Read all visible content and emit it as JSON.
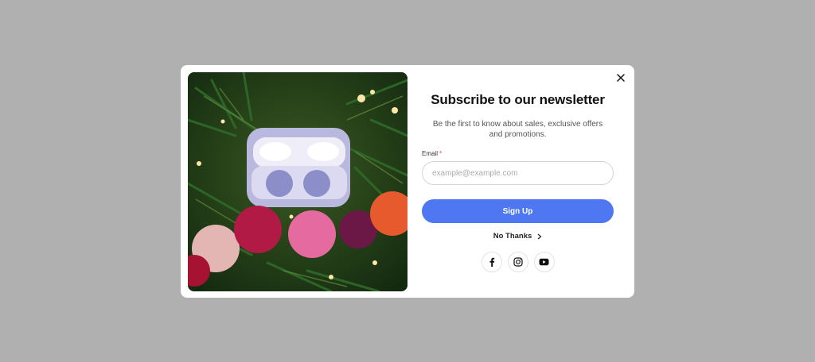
{
  "popup": {
    "title": "Subscribe to our newsletter",
    "subtitle": "Be the first to know about sales, exclusive offers and promotions.",
    "email_label": "Email",
    "required_mark": "*",
    "email_placeholder": "example@example.com",
    "email_value": "",
    "signup_label": "Sign Up",
    "no_thanks_label": "No Thanks",
    "social_links": [
      "facebook-icon",
      "instagram-icon",
      "youtube-icon"
    ],
    "image_description_icon": "earbuds-photo"
  },
  "colors": {
    "overlay": "#b0b0b0",
    "accent": "#4f77f2",
    "required": "#e0413c"
  }
}
